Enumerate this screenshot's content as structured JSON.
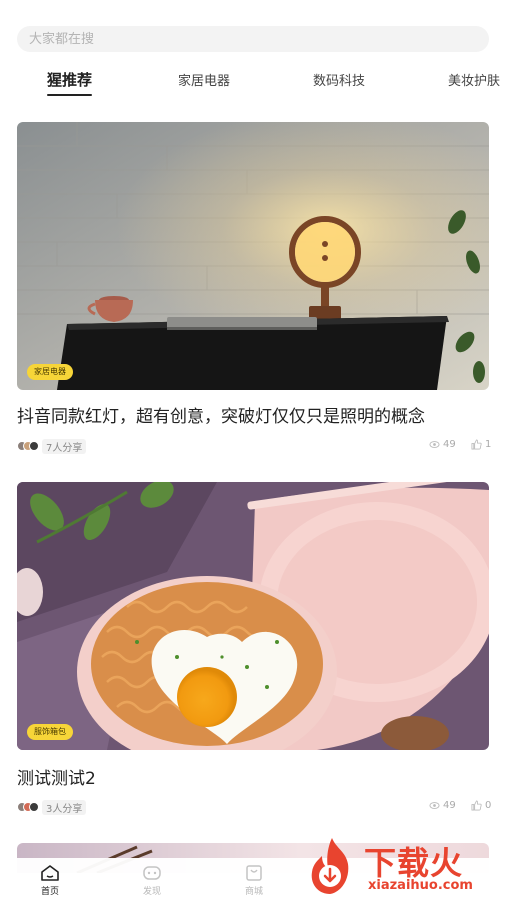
{
  "search": {
    "placeholder": "大家都在搜"
  },
  "tabs": [
    {
      "label": "猩推荐",
      "active": true
    },
    {
      "label": "家居电器",
      "active": false
    },
    {
      "label": "数码科技",
      "active": false
    },
    {
      "label": "美妆护肤",
      "active": false
    }
  ],
  "cards": [
    {
      "badge": "家居电器",
      "title": "抖音同款红灯，超有创意，突破灯仅仅只是照明的概念",
      "share": "7人分享",
      "views": "49",
      "likes": "1"
    },
    {
      "badge": "服饰箱包",
      "title": "测试测试2",
      "share": "3人分享",
      "views": "49",
      "likes": "0"
    }
  ],
  "bottom_nav": [
    {
      "label": "首页",
      "icon": "home-icon",
      "active": true
    },
    {
      "label": "发现",
      "icon": "discover-icon",
      "active": false
    },
    {
      "label": "商城",
      "icon": "shop-icon",
      "active": false
    }
  ],
  "watermark": {
    "title": "下载火",
    "url": "xiazaihuo.com"
  },
  "colors": {
    "accent": "#f7d538",
    "watermark": "#e8442f",
    "text": "#222222"
  }
}
